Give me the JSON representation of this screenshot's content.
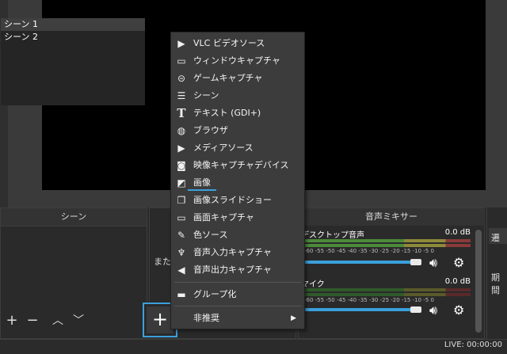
{
  "preview": {},
  "scenes": {
    "title": "シーン",
    "items": [
      "シーン 1",
      "シーン 2"
    ],
    "toolbar": {
      "add": "+",
      "remove": "−",
      "up": "︿",
      "down": "﹀"
    }
  },
  "sources": {
    "partial_text": "また",
    "add_button": "+"
  },
  "mixer": {
    "title": "音声ミキサー",
    "tracks": [
      {
        "name": "デスクトップ音声",
        "db": "0.0 dB"
      },
      {
        "name": "マイク",
        "db": "0.0 dB"
      }
    ],
    "ticks": "-60 -55 -50 -45 -40 -35 -30 -25 -20 -15 -10 -5 0"
  },
  "right": {
    "label_a": "遷",
    "label_b": "期間"
  },
  "status": {
    "live": "LIVE: 00:00:00"
  },
  "menu": {
    "items": [
      {
        "icon": "play-icon",
        "glyph": "▶",
        "label": "VLC ビデオソース"
      },
      {
        "icon": "window-icon",
        "glyph": "▭",
        "label": "ウィンドウキャプチャ"
      },
      {
        "icon": "gamepad-icon",
        "glyph": "⊝",
        "label": "ゲームキャプチャ"
      },
      {
        "icon": "list-icon",
        "glyph": "☰",
        "label": "シーン"
      },
      {
        "icon": "text-icon",
        "glyph": "T",
        "label": "テキスト (GDI+)"
      },
      {
        "icon": "globe-icon",
        "glyph": "◍",
        "label": "ブラウザ"
      },
      {
        "icon": "play-icon",
        "glyph": "▶",
        "label": "メディアソース"
      },
      {
        "icon": "camera-icon",
        "glyph": "◙",
        "label": "映像キャプチャデバイス"
      },
      {
        "icon": "image-icon",
        "glyph": "◩",
        "label": "画像"
      },
      {
        "icon": "slideshow-icon",
        "glyph": "❐",
        "label": "画像スライドショー"
      },
      {
        "icon": "monitor-icon",
        "glyph": "▭",
        "label": "画面キャプチャ"
      },
      {
        "icon": "brush-icon",
        "glyph": "✎",
        "label": "色ソース"
      },
      {
        "icon": "microphone-icon",
        "glyph": "♆",
        "label": "音声入力キャプチャ"
      },
      {
        "icon": "speaker-icon",
        "glyph": "◀",
        "label": "音声出力キャプチャ"
      },
      {
        "icon": "folder-icon",
        "glyph": "▬",
        "label": "グループ化"
      },
      {
        "icon": "",
        "glyph": "",
        "label": "非推奨",
        "arrow": "▶"
      }
    ]
  }
}
